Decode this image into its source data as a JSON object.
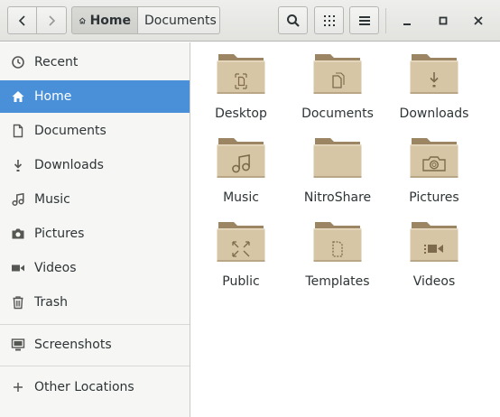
{
  "header": {
    "back_icon": "chevron-left-icon",
    "forward_icon": "chevron-right-icon",
    "path": [
      {
        "label": "Home",
        "icon": "home-icon"
      },
      {
        "label": "Documents"
      }
    ],
    "search_icon": "search-icon",
    "grid_icon": "grid-view-icon",
    "menu_icon": "hamburger-menu-icon",
    "window_controls": [
      "minimize-icon",
      "maximize-icon",
      "close-icon"
    ]
  },
  "sidebar": {
    "items": [
      {
        "label": "Recent",
        "icon": "clock-icon"
      },
      {
        "label": "Home",
        "icon": "home-icon",
        "active": true
      },
      {
        "label": "Documents",
        "icon": "document-icon"
      },
      {
        "label": "Downloads",
        "icon": "download-icon"
      },
      {
        "label": "Music",
        "icon": "music-icon"
      },
      {
        "label": "Pictures",
        "icon": "camera-icon"
      },
      {
        "label": "Videos",
        "icon": "video-icon"
      },
      {
        "label": "Trash",
        "icon": "trash-icon"
      },
      {
        "label": "Screenshots",
        "icon": "drive-icon"
      },
      {
        "label": "Other Locations",
        "icon": "plus-icon"
      }
    ]
  },
  "folders": [
    {
      "label": "Desktop",
      "emblem": "desktop-emblem"
    },
    {
      "label": "Documents",
      "emblem": "documents-emblem"
    },
    {
      "label": "Downloads",
      "emblem": "download-emblem"
    },
    {
      "label": "Music",
      "emblem": "music-emblem"
    },
    {
      "label": "NitroShare",
      "emblem": "none"
    },
    {
      "label": "Pictures",
      "emblem": "camera-emblem"
    },
    {
      "label": "Public",
      "emblem": "share-emblem"
    },
    {
      "label": "Templates",
      "emblem": "template-emblem"
    },
    {
      "label": "Videos",
      "emblem": "video-emblem"
    }
  ],
  "colors": {
    "accent": "#4a90d9",
    "folder_body": "#d7c6a5",
    "folder_tab": "#9c8563"
  }
}
